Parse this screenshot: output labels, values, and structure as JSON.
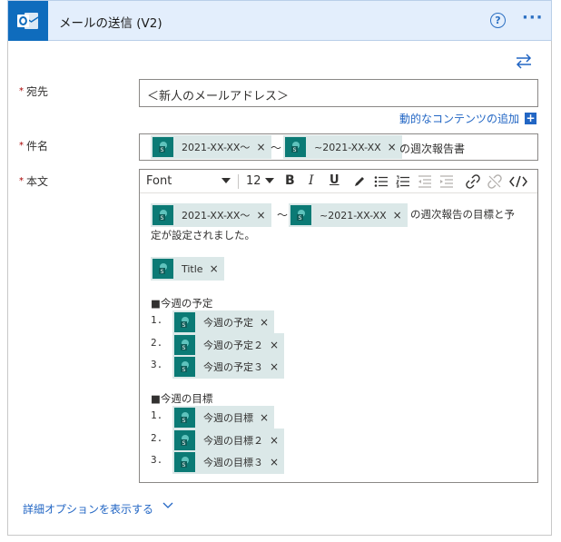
{
  "header": {
    "title": "メールの送信 (V2)",
    "help": "?",
    "more": "···"
  },
  "fields": {
    "to": {
      "label": "宛先",
      "value": "＜新人のメールアドレス＞"
    },
    "dynamic_content": "動的なコンテンツの追加",
    "dynamic_plus": "+",
    "subject": {
      "label": "件名",
      "token1": "2021-XX-XX〜",
      "sep": "〜",
      "token2": "~2021-XX-XX",
      "suffix": "の週次報告書"
    },
    "body": {
      "label": "本文",
      "toolbar": {
        "font": "Font",
        "size": "12",
        "bold": "B",
        "italic": "I",
        "underline": "U"
      },
      "line1_token1": "2021-XX-XX〜",
      "line1_sep": "〜",
      "line1_token2": "~2021-XX-XX",
      "line1_suffix": "の週次報告の目標と予",
      "line2": "定が設定されました。",
      "title_token": "Title",
      "plan_heading": "■今週の予定",
      "plan_items": [
        "今週の予定",
        "今週の予定２",
        "今週の予定３"
      ],
      "goal_heading": "■今週の目標",
      "goal_items": [
        "今週の目標",
        "今週の目標２",
        "今週の目標３"
      ],
      "numbers": [
        "1.",
        "2.",
        "3."
      ]
    }
  },
  "required_mark": "*",
  "remove_glyph": "×",
  "advanced": "詳細オプションを表示する",
  "colors": {
    "accent": "#2266c4",
    "header_bg": "#e3eefc",
    "token_bg": "#dbe8e8",
    "token_icon": "#0b7a75",
    "outlook": "#0f6cbd"
  }
}
